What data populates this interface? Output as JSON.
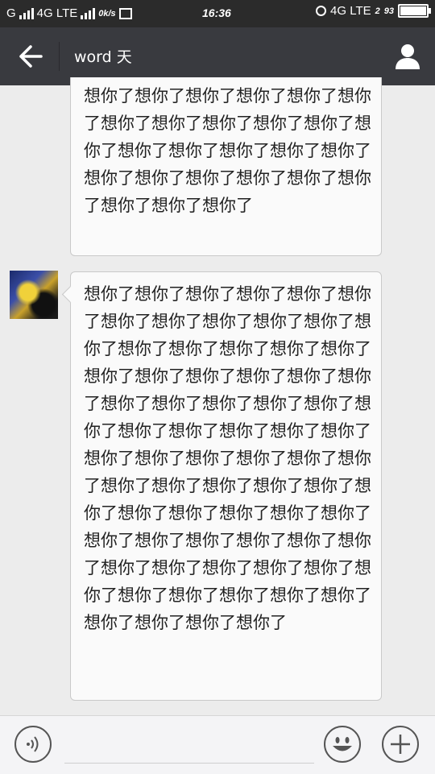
{
  "status_bar": {
    "carrier1": "G",
    "network1": "4G LTE",
    "speed": "0k/s",
    "time": "16:36",
    "network2": "4G LTE",
    "sim2": "2",
    "battery_percent": "93",
    "battery_level": 0.93
  },
  "header": {
    "title": "word 天",
    "back_icon": "arrow-left-icon",
    "profile_icon": "person-icon"
  },
  "messages": [
    {
      "sender": "self",
      "text": "想你了想你了想你了想你了想你了想你了想你了想你了想你了想你了想你了想你了想你了想你了想你了想你了想你了想你了想你了想你了想你了想你了想你了想你了想你了想你了"
    },
    {
      "sender": "other",
      "avatar": "avatar-image",
      "text": "想你了想你了想你了想你了想你了想你了想你了想你了想你了想你了想你了想你了想你了想你了想你了想你了想你了想你了想你了想你了想你了想你了想你了想你了想你了想你了想你了想你了想你了想你了想你了想你了想你了想你了想你了想你了想你了想你了想你了想你了想你了想你了想你了想你了想你了想你了想你了想你了想你了想你了想你了想你了想你了想你了想你了想你了想你了想你了想你了想你了想你了想你了想你了想你了想你了想你了想你了想你了想你了想你了想你了想你了"
    }
  ],
  "input_bar": {
    "voice_icon": "voice-icon",
    "emoji_icon": "emoji-icon",
    "plus_icon": "plus-icon",
    "input_value": ""
  },
  "colors": {
    "status_bar": "#2b2b2b",
    "title_bar": "#393a3f",
    "chat_bg": "#ececec",
    "bubble_bg": "#fafafa"
  }
}
